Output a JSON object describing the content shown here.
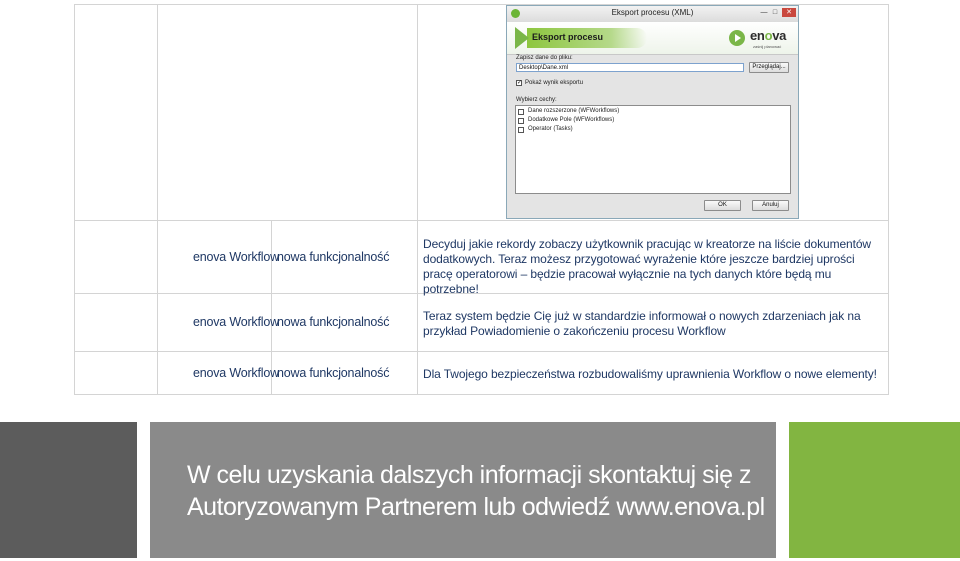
{
  "rows": [
    {
      "product": "enova Workflow",
      "category": "nowa funkcjonalność",
      "description": "Decyduj jakie rekordy zobaczy użytkownik pracując w kreatorze na liście dokumentów dodatkowych. Teraz możesz przygotować wyrażenie które jeszcze bardziej uprości pracę operatorowi – będzie pracował wyłącznie na tych danych które będą mu potrzebne!"
    },
    {
      "product": "enova Workflow",
      "category": "nowa funkcjonalność",
      "description": "Teraz system będzie Cię już w standardzie informował o nowych zdarzeniach jak na przykład Powiadomienie o zakończeniu procesu Workflow"
    },
    {
      "product": "enova Workflow",
      "category": "nowa funkcjonalność",
      "description": "Dla Twojego bezpieczeństwa rozbudowaliśmy uprawnienia Workflow o nowe elementy!"
    }
  ],
  "dialog": {
    "window_title": "Eksport procesu (XML)",
    "banner_title": "Eksport procesu",
    "logo_text_pre": "en",
    "logo_text_o": "o",
    "logo_text_post": "va",
    "logo_sub": "zaśnij planować",
    "save_label": "Zapisz dane do pliku:",
    "path_value": "Desktop\\Dane.xml",
    "browse_button": "Przeglądaj...",
    "show_result_label": "Pokaż wynik eksportu",
    "show_result_checked": true,
    "features_label": "Wybierz cechy:",
    "features": [
      "Dane rozszerzone (WFWorkflows)",
      "Dodatkowe Pole (WFWorkflows)",
      "Operator (Tasks)"
    ],
    "ok_button": "OK",
    "cancel_button": "Anuluj"
  },
  "footer": {
    "text": "W celu uzyskania dalszych informacji skontaktuj się z Autoryzowanym Partnerem lub odwiedź www.enova.pl"
  },
  "colors": {
    "text_navy": "#1f3864",
    "footer_dark": "#5c5c5c",
    "footer_gray": "#8a8a8a",
    "footer_green": "#82b541",
    "enova_green": "#7ab648"
  }
}
